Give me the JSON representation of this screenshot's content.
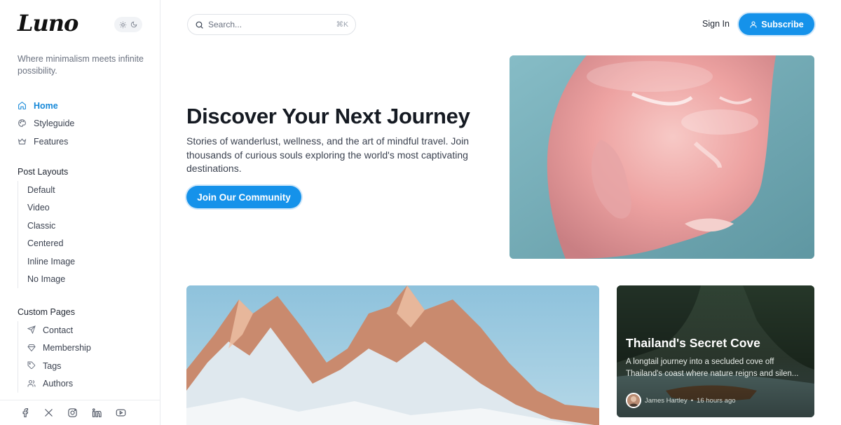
{
  "sidebar": {
    "logo": "Luno",
    "tagline": "Where minimalism meets infinite possibility.",
    "nav": [
      {
        "label": "Home",
        "icon": "home-icon",
        "active": true
      },
      {
        "label": "Styleguide",
        "icon": "palette-icon"
      },
      {
        "label": "Features",
        "icon": "crown-icon"
      }
    ],
    "post_layouts": {
      "title": "Post Layouts",
      "items": [
        "Default",
        "Video",
        "Classic",
        "Centered",
        "Inline Image",
        "No Image"
      ]
    },
    "custom_pages": {
      "title": "Custom Pages",
      "items": [
        {
          "label": "Contact",
          "icon": "send-icon"
        },
        {
          "label": "Membership",
          "icon": "diamond-icon"
        },
        {
          "label": "Tags",
          "icon": "tag-icon"
        },
        {
          "label": "Authors",
          "icon": "users-icon"
        }
      ]
    },
    "social": [
      "facebook-icon",
      "x-icon",
      "instagram-icon",
      "linkedin-icon",
      "youtube-icon"
    ]
  },
  "header": {
    "search_placeholder": "Search...",
    "search_shortcut": "⌘K",
    "signin": "Sign In",
    "subscribe": "Subscribe"
  },
  "hero": {
    "title": "Discover Your Next Journey",
    "description": "Stories of wanderlust, wellness, and the art of mindful travel. Join thousands of curious souls exploring the world's most captivating destinations.",
    "cta": "Join Our Community"
  },
  "featured_card": {
    "title": "Thailand's Secret Cove",
    "excerpt": "A longtail journey into a secluded cove off Thailand's coast where nature reigns and silen...",
    "author": "James Hartley",
    "separator": "•",
    "time": "16 hours ago"
  },
  "colors": {
    "accent": "#1592ea",
    "active_nav": "#1688d8"
  }
}
